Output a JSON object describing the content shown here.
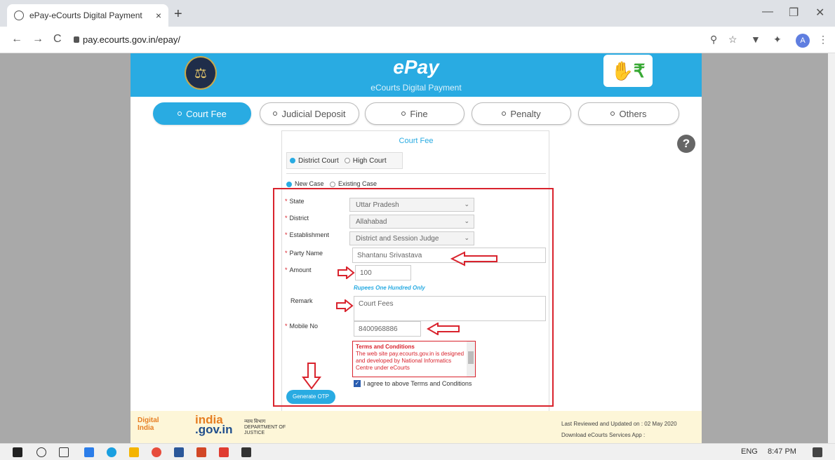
{
  "browser": {
    "tab_title": "ePay-eCourts Digital Payment",
    "tab_close": "×",
    "new_tab": "+",
    "url": "pay.ecourts.gov.in/epay/",
    "profile_initial": "A",
    "minimize": "—",
    "maximize": "❐",
    "close": "✕"
  },
  "header": {
    "title": "ePay",
    "subtitle": "eCourts Digital Payment"
  },
  "tabs": [
    {
      "label": "Court Fee",
      "active": true
    },
    {
      "label": "Judicial Deposit",
      "active": false
    },
    {
      "label": "Fine",
      "active": false
    },
    {
      "label": "Penalty",
      "active": false
    },
    {
      "label": "Others",
      "active": false
    }
  ],
  "form": {
    "title": "Court Fee",
    "court_options": [
      "District Court",
      "High Court"
    ],
    "case_options": [
      "New Case",
      "Existing Case"
    ],
    "fields": {
      "state_label": "State",
      "state_value": "Uttar Pradesh",
      "district_label": "District",
      "district_value": "Allahabad",
      "establishment_label": "Establishment",
      "establishment_value": "District and Session Judge",
      "party_label": "Party Name",
      "party_value": "Shantanu Srivastava",
      "amount_label": "Amount",
      "amount_value": "100",
      "amount_words": "Rupees One Hundred Only",
      "remark_label": "Remark",
      "remark_value": "Court Fees",
      "mobile_label": "Mobile No",
      "mobile_value": "8400968886"
    },
    "terms": {
      "heading": "Terms and Conditions",
      "text": "The web site pay.ecourts.gov.in is designed and developed by National Informatics Centre under eCourts"
    },
    "agree_label": "I agree to above Terms and Conditions",
    "generate_otp_label": "Generate OTP"
  },
  "footer": {
    "digital_india": "Digital India",
    "india_gov_1": "india",
    "india_gov_2": ".gov.in",
    "doj_hindi": "न्याय विभाग",
    "doj_line1": "DEPARTMENT OF",
    "doj_line2": "JUSTICE",
    "reviewed": "Last Reviewed and Updated on : 02 May 2020",
    "download": "Download eCourts Services App :"
  },
  "taskbar": {
    "lang": "ENG",
    "time": "8:47 PM"
  },
  "colors": {
    "brand_blue": "#29abe2",
    "highlight_red": "#d9232d"
  }
}
